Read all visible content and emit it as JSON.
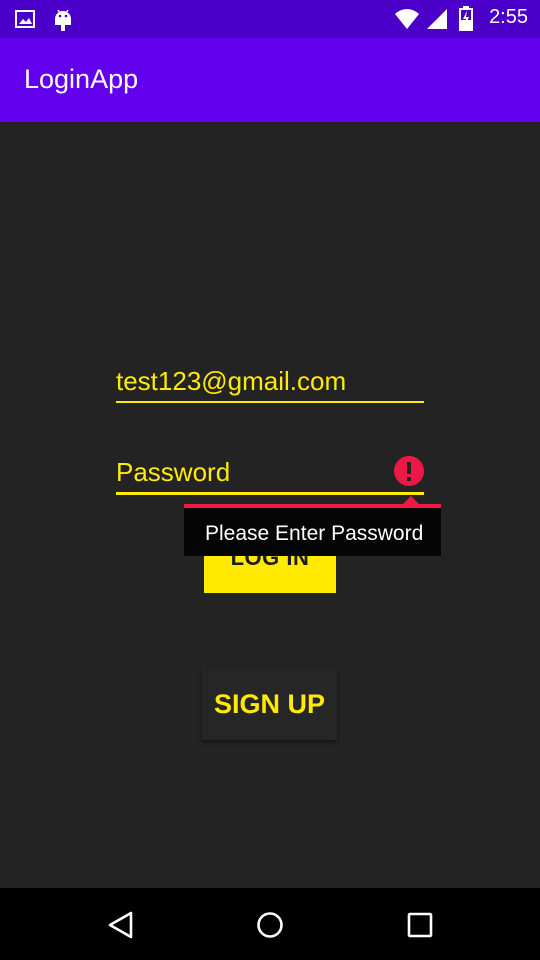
{
  "status_bar": {
    "time": "2:55",
    "icons": [
      "gallery-icon",
      "android-icon",
      "wifi-icon",
      "signal-icon",
      "battery-icon"
    ]
  },
  "app_bar": {
    "title": "LoginApp"
  },
  "form": {
    "email_value": "test123@gmail.com",
    "password_placeholder": "Password",
    "error_message": "Please Enter Password",
    "login_label": "LOG IN",
    "signup_label": "SIGN UP"
  },
  "nav_bar": {
    "icons": [
      "back-icon",
      "home-icon",
      "recents-icon"
    ]
  },
  "colors": {
    "accent": "#ffea00",
    "primary": "#6200ee",
    "primary_dark": "#4a00c8",
    "background": "#232323",
    "error": "#ee1846"
  }
}
